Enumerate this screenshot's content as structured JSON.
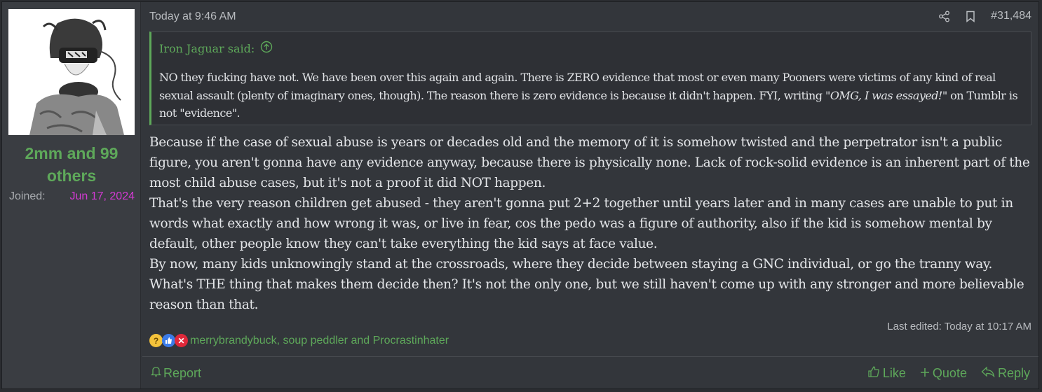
{
  "author": {
    "username": "2mm and 99 others",
    "joined_label": "Joined:",
    "joined_date": "Jun 17, 2024"
  },
  "post": {
    "date": "Today at 9:46 AM",
    "number": "#31,484",
    "quote": {
      "author": "Iron Jaguar said:",
      "text_before": "NO they fucking have not. We have been over this again and again. There is ZERO evidence that most or even many Pooners were victims of any kind of real sexual assault (plenty of imaginary ones, though). The reason there is zero evidence is because it didn't happen. FYI, writing \"",
      "text_italic": "OMG, I was essayed!",
      "text_after": "\" on Tumblr is not \"evidence\"."
    },
    "paragraphs": [
      "Because if the case of sexual abuse is years or decades old and the memory of it is somehow twisted and the perpetrator isn't a public figure, you aren't gonna have any evidence anyway, because there is physically none. Lack of rock-solid evidence is an inherent part of the most child abuse cases, but it's not a proof it did NOT happen.",
      "That's the very reason children get abused - they aren't gonna put 2+2 together until years later and in many cases are unable to put in words what exactly and how wrong it was, or live in fear, cos the pedo was a figure of authority, also if the kid is somehow mental by default, other people know they can't take everything the kid says at face value.",
      "By now, many kids unknowingly stand at the crossroads, where they decide between staying a GNC individual, or go the tranny way. What's THE thing that makes them decide then? It's not the only one, but we still haven't come up with any stronger and more believable reason than that."
    ],
    "last_edited": "Last edited: Today at 10:17 AM",
    "reactions": {
      "icons": [
        "thinking-face-icon",
        "thumbs-up-icon",
        "x-mark-icon"
      ],
      "users": "merrybrandybuck, soup peddler and Procrastinhater"
    }
  },
  "footer": {
    "report": "Report",
    "like": "Like",
    "quote": "Quote",
    "reply": "Reply"
  },
  "colors": {
    "accent": "#5ea85a",
    "date_highlight": "#d43ad4",
    "background": "#33363b"
  }
}
